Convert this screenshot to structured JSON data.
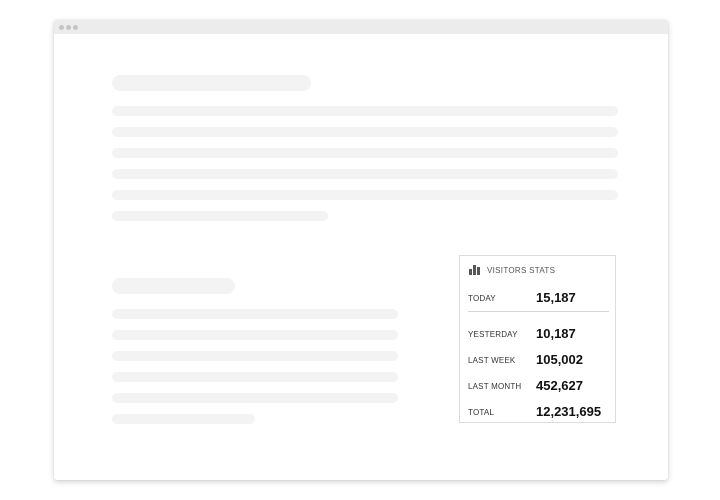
{
  "window": {
    "traffic_light_color": "#c4c4c4",
    "titlebar_color": "#ececec"
  },
  "placeholder_color": "#f3f3f3",
  "widget": {
    "icon": "bar-chart-icon",
    "title": "VISITORS STATS",
    "rows": [
      {
        "label": "TODAY",
        "value": "15,187"
      },
      {
        "label": "YESTERDAY",
        "value": "10,187"
      },
      {
        "label": "LAST WEEK",
        "value": "105,002"
      },
      {
        "label": "LAST MONTH",
        "value": "452,627"
      },
      {
        "label": "TOTAL",
        "value": "12,231,695"
      }
    ]
  }
}
